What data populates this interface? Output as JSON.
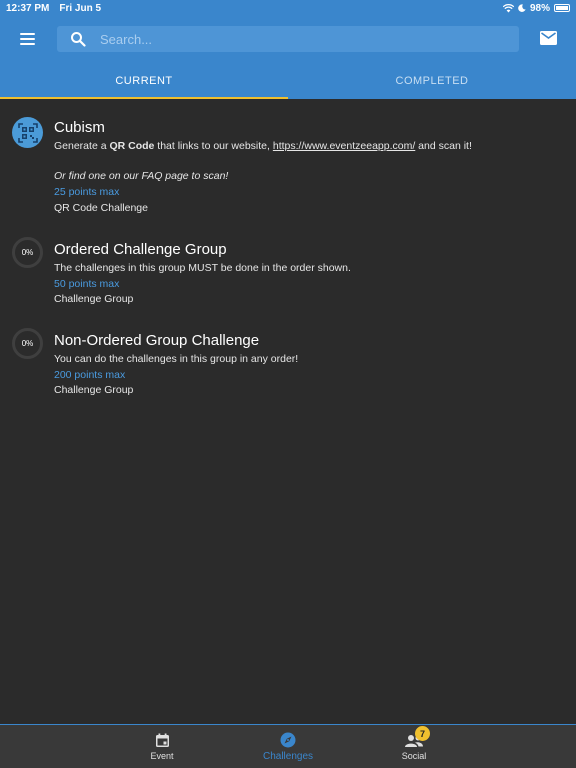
{
  "status_bar": {
    "time": "12:37 PM",
    "date": "Fri Jun 5",
    "battery": "98%"
  },
  "header": {
    "search_placeholder": "Search...",
    "tabs": [
      {
        "label": "CURRENT",
        "active": true
      },
      {
        "label": "COMPLETED",
        "active": false
      }
    ],
    "accent_color": "#3a86cc",
    "indicator_color": "#f0c02e"
  },
  "challenges": [
    {
      "title": "Cubism",
      "desc_prefix": "Generate a ",
      "desc_bold": "QR Code",
      "desc_middle": " that links to our website, ",
      "desc_link": "https://www.eventzeeapp.com/",
      "desc_suffix": " and scan it!",
      "note": "Or find one on our FAQ page to scan!",
      "points": "25 points max",
      "type": "QR Code Challenge",
      "icon": "qr-code-icon"
    },
    {
      "title": "Ordered Challenge Group",
      "progress": "0%",
      "description": "The challenges in this group MUST be done in the order shown.",
      "points": "50 points max",
      "type": "Challenge Group"
    },
    {
      "title": "Non-Ordered Group Challenge",
      "progress": "0%",
      "description": "You can do the challenges in this group in any order!",
      "points": "200 points max",
      "type": "Challenge Group"
    }
  ],
  "bottom_nav": {
    "items": [
      {
        "label": "Event",
        "icon": "calendar-icon"
      },
      {
        "label": "Challenges",
        "icon": "compass-icon",
        "active": true
      },
      {
        "label": "Social",
        "icon": "people-icon",
        "badge": "7"
      }
    ]
  }
}
